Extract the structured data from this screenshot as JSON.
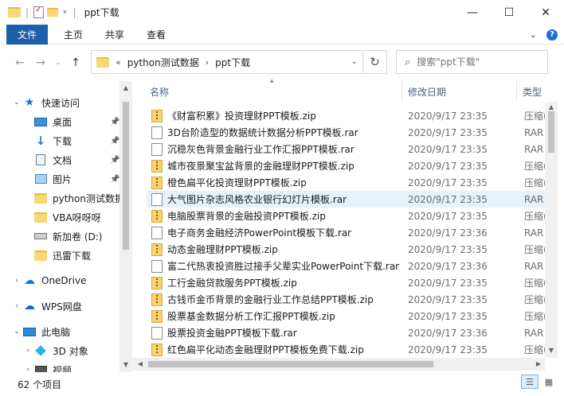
{
  "window": {
    "title": "ppt下载",
    "controls": {
      "minimize": "—",
      "maximize": "☐",
      "close": "✕"
    }
  },
  "ribbon": {
    "tabs": [
      "文件",
      "主页",
      "共享",
      "查看"
    ],
    "expand_icon": "chevron-down-icon",
    "help_label": "?"
  },
  "address": {
    "prefix": "«",
    "crumbs": [
      "python测试数据",
      "ppt下载"
    ]
  },
  "search": {
    "placeholder": "搜索\"ppt下载\""
  },
  "sidebar": {
    "items": [
      {
        "label": "快速访问",
        "icon": "star-icon",
        "expander": "expanded",
        "pinned": false
      },
      {
        "label": "桌面",
        "icon": "desktop-icon",
        "pinned": true
      },
      {
        "label": "下载",
        "icon": "download-icon",
        "pinned": true
      },
      {
        "label": "文档",
        "icon": "document-icon",
        "pinned": true
      },
      {
        "label": "图片",
        "icon": "pictures-icon",
        "pinned": true
      },
      {
        "label": "python测试数据",
        "icon": "folder-icon",
        "pinned": false
      },
      {
        "label": "VBA呀呀呀",
        "icon": "folder-icon",
        "pinned": false
      },
      {
        "label": "新加卷 (D:)",
        "icon": "drive-icon",
        "pinned": false
      },
      {
        "label": "迅雷下载",
        "icon": "folder-icon",
        "pinned": false
      },
      {
        "label": "OneDrive",
        "icon": "cloud-icon",
        "expander": "collapsed",
        "pinned": false
      },
      {
        "label": "WPS网盘",
        "icon": "wps-cloud-icon",
        "expander": "collapsed",
        "pinned": false
      },
      {
        "label": "此电脑",
        "icon": "computer-icon",
        "expander": "expanded",
        "pinned": false
      },
      {
        "label": "3D 对象",
        "icon": "3d-objects-icon",
        "expander": "collapsed",
        "pinned": false
      },
      {
        "label": "视频",
        "icon": "video-icon",
        "expander": "collapsed",
        "pinned": false
      }
    ]
  },
  "list": {
    "columns": {
      "name": "名称",
      "modified": "修改日期",
      "type": "类型"
    },
    "files": [
      {
        "name": "《财富积累》投资理财PPT模板.zip",
        "date": "2020/9/17 23:35",
        "type": "压缩(",
        "kind": "zip"
      },
      {
        "name": "3D台阶造型的数据统计数据分析PPT模板.rar",
        "date": "2020/9/17 23:35",
        "type": "RAR",
        "kind": "rar"
      },
      {
        "name": "沉稳灰色背景金融行业工作汇报PPT模板.rar",
        "date": "2020/9/17 23:35",
        "type": "RAR",
        "kind": "rar"
      },
      {
        "name": "城市夜景聚宝盆背景的金融理财PPT模板.zip",
        "date": "2020/9/17 23:35",
        "type": "压缩(",
        "kind": "zip"
      },
      {
        "name": "橙色扁平化投资理财PPT模板.zip",
        "date": "2020/9/17 23:35",
        "type": "压缩(",
        "kind": "zip"
      },
      {
        "name": "大气图片杂志风格农业银行幻灯片模板.rar",
        "date": "2020/9/17 23:35",
        "type": "RAR",
        "kind": "rar",
        "selected": true
      },
      {
        "name": "电脑股票背景的金融投资PPT模板.zip",
        "date": "2020/9/17 23:35",
        "type": "压缩(",
        "kind": "zip"
      },
      {
        "name": "电子商务金融经济PowerPoint模板下载.rar",
        "date": "2020/9/17 23:36",
        "type": "RAR",
        "kind": "rar"
      },
      {
        "name": "动态金融理财PPT模板.zip",
        "date": "2020/9/17 23:35",
        "type": "压缩(",
        "kind": "zip"
      },
      {
        "name": "富二代热衷投资胜过接手父辈实业PowerPoint下载.rar",
        "date": "2020/9/17 23:36",
        "type": "RAR",
        "kind": "rar"
      },
      {
        "name": "工行金融贷款服务PPT模板.zip",
        "date": "2020/9/17 23:35",
        "type": "压缩(",
        "kind": "zip"
      },
      {
        "name": "古钱币金币背景的金融行业工作总结PPT模板.zip",
        "date": "2020/9/17 23:35",
        "type": "压缩(",
        "kind": "zip"
      },
      {
        "name": "股票基金数据分析工作汇报PPT模板.zip",
        "date": "2020/9/17 23:35",
        "type": "压缩(",
        "kind": "zip"
      },
      {
        "name": "股票投资金融PPT模板下载.rar",
        "date": "2020/9/17 23:36",
        "type": "RAR",
        "kind": "rar"
      },
      {
        "name": "红色扁平化动态金融理财PPT模板免费下载.zip",
        "date": "2020/9/17 23:35",
        "type": "压缩(",
        "kind": "zip"
      }
    ]
  },
  "status": {
    "count": "62 个项目"
  },
  "colors": {
    "accent": "#1f5ea8",
    "selection": "#e5f1fb",
    "folder": "#f8d775"
  }
}
